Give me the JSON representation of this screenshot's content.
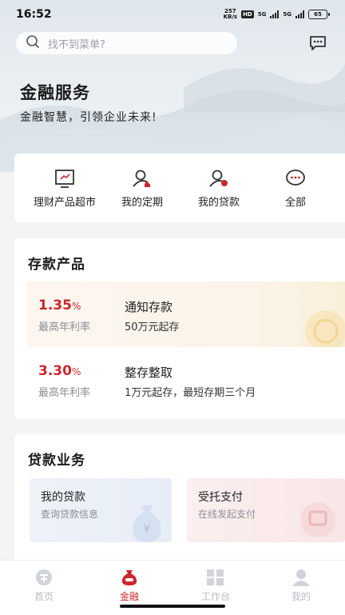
{
  "status": {
    "time": "16:52",
    "speed_top": "257",
    "speed_bottom": "KB/s",
    "hd": "HD",
    "net1": "5G",
    "net2": "5G",
    "battery": "65"
  },
  "search": {
    "placeholder": "找不到菜单?",
    "icon": "search-icon"
  },
  "header": {
    "message_icon": "message-icon"
  },
  "hero": {
    "title": "金融服务",
    "subtitle": "金融智慧，引领企业未来!"
  },
  "quick_menu": [
    {
      "label": "理财产品超市",
      "icon": "chart-board-icon"
    },
    {
      "label": "我的定期",
      "icon": "user-deposit-icon"
    },
    {
      "label": "我的贷款",
      "icon": "user-loan-icon"
    },
    {
      "label": "全部",
      "icon": "more-icon"
    }
  ],
  "deposit": {
    "title": "存款产品",
    "products": [
      {
        "rate": "1.35",
        "unit": "%",
        "rate_label": "最高年利率",
        "name": "通知存款",
        "desc": "50万元起存"
      },
      {
        "rate": "3.30",
        "unit": "%",
        "rate_label": "最高年利率",
        "name": "整存整取",
        "desc": "1万元起存，最短存期三个月"
      }
    ]
  },
  "loan": {
    "title": "贷款业务",
    "cards": [
      {
        "title": "我的贷款",
        "desc": "查询贷款信息"
      },
      {
        "title": "受托支付",
        "desc": "在线发起支付"
      }
    ]
  },
  "tabs": [
    {
      "label": "首页",
      "icon": "home-icon",
      "active": false
    },
    {
      "label": "金融",
      "icon": "money-bag-icon",
      "active": true
    },
    {
      "label": "工作台",
      "icon": "workbench-icon",
      "active": false
    },
    {
      "label": "我的",
      "icon": "profile-icon",
      "active": false
    }
  ],
  "colors": {
    "accent": "#c8282d",
    "gray_text": "#8a8f96",
    "tab_inactive": "#b8bcc2"
  }
}
